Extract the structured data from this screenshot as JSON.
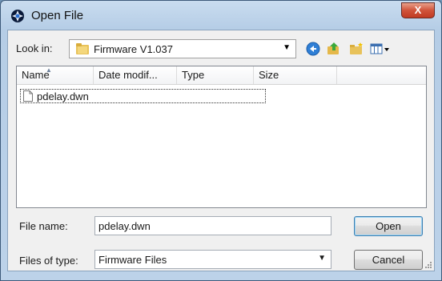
{
  "window": {
    "title": "Open File",
    "close_symbol": "X"
  },
  "lookin": {
    "label": "Look in:",
    "value": "Firmware V1.037"
  },
  "toolbar": {
    "icons": [
      "back-icon",
      "up-folder-icon",
      "new-folder-icon",
      "views-menu-icon"
    ]
  },
  "columns": [
    "Name",
    "Date modif...",
    "Type",
    "Size"
  ],
  "files": [
    {
      "name": "pdelay.dwn"
    }
  ],
  "filename": {
    "label": "File name:",
    "value": "pdelay.dwn"
  },
  "filetype": {
    "label": "Files of type:",
    "value": "Firmware Files"
  },
  "buttons": {
    "open": "Open",
    "cancel": "Cancel"
  },
  "colors": {
    "title_bar": "#bcd2e9",
    "close_button": "#c13a22",
    "default_button_border": "#3c7fb1"
  }
}
